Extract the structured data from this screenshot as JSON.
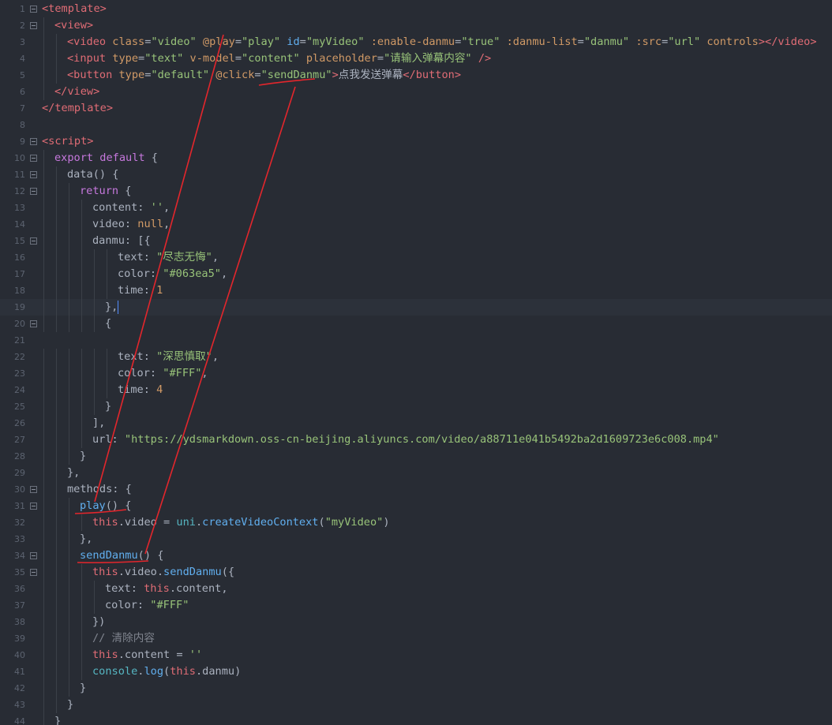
{
  "editor": {
    "lines": [
      {
        "n": "1",
        "fold": true,
        "indent": 0,
        "tokens": [
          [
            "tag",
            "<template>"
          ]
        ]
      },
      {
        "n": "2",
        "fold": true,
        "indent": 1,
        "tokens": [
          [
            "tag",
            "<view>"
          ]
        ]
      },
      {
        "n": "3",
        "fold": false,
        "indent": 2,
        "tokens": [
          [
            "tag",
            "<video"
          ],
          [
            "punc",
            " "
          ],
          [
            "attr",
            "class"
          ],
          [
            "punc",
            "="
          ],
          [
            "str",
            "\"video\""
          ],
          [
            "punc",
            " "
          ],
          [
            "attr",
            "@play"
          ],
          [
            "punc",
            "="
          ],
          [
            "str",
            "\"play\""
          ],
          [
            "punc",
            " "
          ],
          [
            "dir",
            "id"
          ],
          [
            "punc",
            "="
          ],
          [
            "str",
            "\"myVideo\""
          ],
          [
            "punc",
            " "
          ],
          [
            "attr",
            ":enable-danmu"
          ],
          [
            "punc",
            "="
          ],
          [
            "str",
            "\"true\""
          ],
          [
            "punc",
            " "
          ],
          [
            "attr",
            ":danmu-list"
          ],
          [
            "punc",
            "="
          ],
          [
            "str",
            "\"danmu\""
          ],
          [
            "punc",
            " "
          ],
          [
            "attr",
            ":src"
          ],
          [
            "punc",
            "="
          ],
          [
            "str",
            "\"url\""
          ],
          [
            "punc",
            " "
          ],
          [
            "attr",
            "controls"
          ],
          [
            "tag",
            ">"
          ],
          [
            "tag",
            "</video>"
          ]
        ]
      },
      {
        "n": "4",
        "fold": false,
        "indent": 2,
        "tokens": [
          [
            "tag",
            "<input"
          ],
          [
            "punc",
            " "
          ],
          [
            "attr",
            "type"
          ],
          [
            "punc",
            "="
          ],
          [
            "str",
            "\"text\""
          ],
          [
            "punc",
            " "
          ],
          [
            "attr",
            "v-model"
          ],
          [
            "punc",
            "="
          ],
          [
            "str",
            "\"content\""
          ],
          [
            "punc",
            " "
          ],
          [
            "attr",
            "placeholder"
          ],
          [
            "punc",
            "="
          ],
          [
            "str",
            "\"请输入弹幕内容\""
          ],
          [
            "punc",
            " "
          ],
          [
            "tag",
            "/>"
          ]
        ]
      },
      {
        "n": "5",
        "fold": false,
        "indent": 2,
        "tokens": [
          [
            "tag",
            "<button"
          ],
          [
            "punc",
            " "
          ],
          [
            "attr",
            "type"
          ],
          [
            "punc",
            "="
          ],
          [
            "str",
            "\"default\""
          ],
          [
            "punc",
            " "
          ],
          [
            "attr",
            "@click"
          ],
          [
            "punc",
            "="
          ],
          [
            "str",
            "\"sendDanmu\""
          ],
          [
            "tag",
            ">"
          ],
          [
            "punc",
            "点我发送弹幕"
          ],
          [
            "tag",
            "</button>"
          ]
        ]
      },
      {
        "n": "6",
        "fold": false,
        "indent": 1,
        "tokens": [
          [
            "tag",
            "</view>"
          ]
        ]
      },
      {
        "n": "7",
        "fold": false,
        "indent": 0,
        "tokens": [
          [
            "tag",
            "</template>"
          ]
        ]
      },
      {
        "n": "8",
        "fold": false,
        "indent": 0,
        "tokens": []
      },
      {
        "n": "9",
        "fold": true,
        "indent": 0,
        "tokens": [
          [
            "tag",
            "<script>"
          ]
        ]
      },
      {
        "n": "10",
        "fold": true,
        "indent": 1,
        "tokens": [
          [
            "kw",
            "export"
          ],
          [
            "punc",
            " "
          ],
          [
            "kw",
            "default"
          ],
          [
            "punc",
            " {"
          ]
        ]
      },
      {
        "n": "11",
        "fold": true,
        "indent": 2,
        "tokens": [
          [
            "punc",
            "data() {"
          ]
        ]
      },
      {
        "n": "12",
        "fold": true,
        "indent": 3,
        "tokens": [
          [
            "kw",
            "return"
          ],
          [
            "punc",
            " {"
          ]
        ]
      },
      {
        "n": "13",
        "fold": false,
        "indent": 4,
        "tokens": [
          [
            "punc",
            "content: "
          ],
          [
            "str",
            "''"
          ],
          [
            "punc",
            ","
          ]
        ]
      },
      {
        "n": "14",
        "fold": false,
        "indent": 4,
        "tokens": [
          [
            "punc",
            "video: "
          ],
          [
            "null",
            "null"
          ],
          [
            "punc",
            ","
          ]
        ]
      },
      {
        "n": "15",
        "fold": true,
        "indent": 4,
        "tokens": [
          [
            "punc",
            "danmu: [{"
          ]
        ]
      },
      {
        "n": "16",
        "fold": false,
        "indent": 6,
        "tokens": [
          [
            "punc",
            "text: "
          ],
          [
            "str",
            "\"尽志无悔\""
          ],
          [
            "punc",
            ","
          ]
        ]
      },
      {
        "n": "17",
        "fold": false,
        "indent": 6,
        "tokens": [
          [
            "punc",
            "color: "
          ],
          [
            "str",
            "\"#063ea5\""
          ],
          [
            "punc",
            ","
          ]
        ]
      },
      {
        "n": "18",
        "fold": false,
        "indent": 6,
        "tokens": [
          [
            "punc",
            "time: "
          ],
          [
            "num",
            "1"
          ]
        ]
      },
      {
        "n": "19",
        "fold": false,
        "indent": 5,
        "active": true,
        "cursor": true,
        "tokens": [
          [
            "punc",
            "},"
          ]
        ]
      },
      {
        "n": "20",
        "fold": true,
        "indent": 5,
        "tokens": [
          [
            "punc",
            "{"
          ]
        ]
      },
      {
        "n": "21",
        "fold": false,
        "indent": 0,
        "tokens": []
      },
      {
        "n": "22",
        "fold": false,
        "indent": 6,
        "tokens": [
          [
            "punc",
            "text: "
          ],
          [
            "str",
            "\"深思慎取\""
          ],
          [
            "punc",
            ","
          ]
        ]
      },
      {
        "n": "23",
        "fold": false,
        "indent": 6,
        "tokens": [
          [
            "punc",
            "color: "
          ],
          [
            "str",
            "\"#FFF\""
          ],
          [
            "punc",
            ","
          ]
        ]
      },
      {
        "n": "24",
        "fold": false,
        "indent": 6,
        "tokens": [
          [
            "punc",
            "time: "
          ],
          [
            "num",
            "4"
          ]
        ]
      },
      {
        "n": "25",
        "fold": false,
        "indent": 5,
        "tokens": [
          [
            "punc",
            "}"
          ]
        ]
      },
      {
        "n": "26",
        "fold": false,
        "indent": 4,
        "tokens": [
          [
            "punc",
            "],"
          ]
        ]
      },
      {
        "n": "27",
        "fold": false,
        "indent": 4,
        "tokens": [
          [
            "punc",
            "url: "
          ],
          [
            "str",
            "\"https://ydsmarkdown.oss-cn-beijing.aliyuncs.com/video/a88711e041b5492ba2d1609723e6c008.mp4\""
          ]
        ]
      },
      {
        "n": "28",
        "fold": false,
        "indent": 3,
        "tokens": [
          [
            "punc",
            "}"
          ]
        ]
      },
      {
        "n": "29",
        "fold": false,
        "indent": 2,
        "tokens": [
          [
            "punc",
            "},"
          ]
        ]
      },
      {
        "n": "30",
        "fold": true,
        "indent": 2,
        "tokens": [
          [
            "punc",
            "methods: {"
          ]
        ]
      },
      {
        "n": "31",
        "fold": true,
        "indent": 3,
        "tokens": [
          [
            "fn",
            "play"
          ],
          [
            "punc",
            "() {"
          ]
        ]
      },
      {
        "n": "32",
        "fold": false,
        "indent": 4,
        "tokens": [
          [
            "prop",
            "this"
          ],
          [
            "punc",
            ".video = "
          ],
          [
            "obj",
            "uni"
          ],
          [
            "punc",
            "."
          ],
          [
            "fn",
            "createVideoContext"
          ],
          [
            "punc",
            "("
          ],
          [
            "str",
            "\"myVideo\""
          ],
          [
            "punc",
            ")"
          ]
        ]
      },
      {
        "n": "33",
        "fold": false,
        "indent": 3,
        "tokens": [
          [
            "punc",
            "},"
          ]
        ]
      },
      {
        "n": "34",
        "fold": true,
        "indent": 3,
        "tokens": [
          [
            "fn",
            "sendDanmu"
          ],
          [
            "punc",
            "() {"
          ]
        ]
      },
      {
        "n": "35",
        "fold": true,
        "indent": 4,
        "tokens": [
          [
            "prop",
            "this"
          ],
          [
            "punc",
            ".video."
          ],
          [
            "fn",
            "sendDanmu"
          ],
          [
            "punc",
            "({"
          ]
        ]
      },
      {
        "n": "36",
        "fold": false,
        "indent": 5,
        "tokens": [
          [
            "punc",
            "text: "
          ],
          [
            "prop",
            "this"
          ],
          [
            "punc",
            ".content,"
          ]
        ]
      },
      {
        "n": "37",
        "fold": false,
        "indent": 5,
        "tokens": [
          [
            "punc",
            "color: "
          ],
          [
            "str",
            "\"#FFF\""
          ]
        ]
      },
      {
        "n": "38",
        "fold": false,
        "indent": 4,
        "tokens": [
          [
            "punc",
            "})"
          ]
        ]
      },
      {
        "n": "39",
        "fold": false,
        "indent": 4,
        "tokens": [
          [
            "cmt",
            "// 清除内容"
          ]
        ]
      },
      {
        "n": "40",
        "fold": false,
        "indent": 4,
        "tokens": [
          [
            "prop",
            "this"
          ],
          [
            "punc",
            ".content = "
          ],
          [
            "str",
            "''"
          ]
        ]
      },
      {
        "n": "41",
        "fold": false,
        "indent": 4,
        "tokens": [
          [
            "obj",
            "console"
          ],
          [
            "punc",
            "."
          ],
          [
            "fn",
            "log"
          ],
          [
            "punc",
            "("
          ],
          [
            "prop",
            "this"
          ],
          [
            "punc",
            ".danmu)"
          ]
        ]
      },
      {
        "n": "42",
        "fold": false,
        "indent": 3,
        "tokens": [
          [
            "punc",
            "}"
          ]
        ]
      },
      {
        "n": "43",
        "fold": false,
        "indent": 2,
        "tokens": [
          [
            "punc",
            "}"
          ]
        ]
      },
      {
        "n": "44",
        "fold": false,
        "indent": 1,
        "tokens": [
          [
            "punc",
            "}"
          ]
        ]
      }
    ]
  },
  "colors": {
    "annotation": "#e3262c",
    "background": "#282c34",
    "cursor": "#528bff"
  }
}
